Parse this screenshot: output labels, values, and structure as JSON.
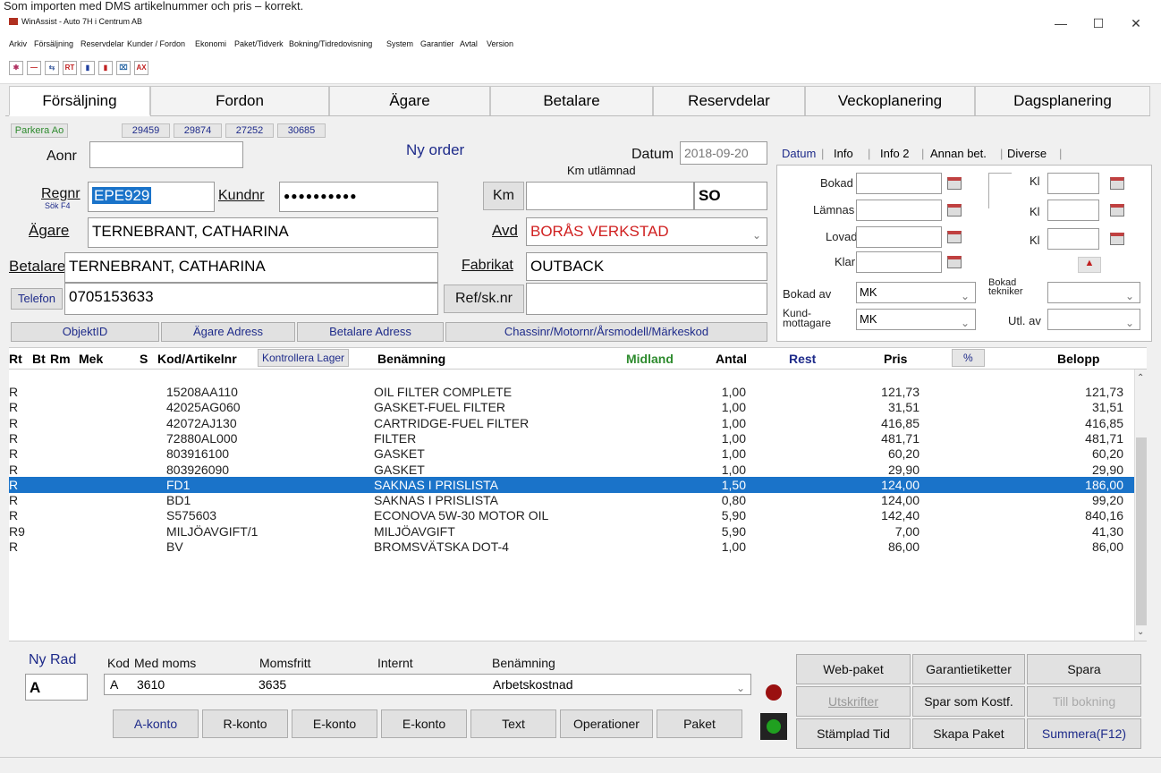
{
  "caption": "Som importen med DMS artikelnummer och pris – korrekt.",
  "window": {
    "title": "WinAssist - Auto 7H i Centrum AB",
    "min": "—",
    "max": "☐",
    "close": "✕"
  },
  "menu": [
    "Arkiv",
    "Försäljning",
    "Reservdelar",
    "Kunder / Fordon",
    "Ekonomi",
    "Paket/Tidverk",
    "Bokning/Tidredovisning",
    "System",
    "Garantier",
    "Avtal",
    "Version"
  ],
  "toolbar": [
    "✱",
    "—",
    "⇆",
    "RT",
    "▮",
    "▮",
    "⌧",
    "AX"
  ],
  "tabs": [
    "Försäljning",
    "Fordon",
    "Ägare",
    "Betalare",
    "Reservdelar",
    "Veckoplanering",
    "Dagsplanering"
  ],
  "parked": {
    "label": "Parkera Ao",
    "orders": [
      "29459",
      "29874",
      "27252",
      "30685"
    ]
  },
  "order": {
    "aonr_label": "Aonr",
    "aonr": "",
    "status": "Ny order",
    "datum_label": "Datum",
    "datum": "2018-09-20",
    "km_utlamnad": "Km utlämnad",
    "regnr_label": "Regnr",
    "regnr_hint": "Sök F4",
    "regnr": "EPE929",
    "kundnr_label": "Kundnr",
    "kundnr": "●●●●●●●●●●",
    "km_button": "Km",
    "km": "",
    "km_code": "SO",
    "agare_label": "Ägare",
    "agare": "TERNEBRANT, CATHARINA",
    "avd_label": "Avd",
    "avd": "BORÅS VERKSTAD",
    "betalare_label": "Betalare",
    "betalare": "TERNEBRANT, CATHARINA",
    "fabrikat_label": "Fabrikat",
    "fabrikat": "OUTBACK",
    "telefon_button": "Telefon",
    "telefon": "0705153633",
    "ref_button": "Ref/sk.nr",
    "ref": ""
  },
  "info_buttons": [
    "ObjektID",
    "Ägare Adress",
    "Betalare Adress",
    "Chassinr/Motornr/Årsmodell/Märkeskod"
  ],
  "subtabs": [
    "Datum",
    "Info",
    "Info 2",
    "Annan bet.",
    "Diverse"
  ],
  "subpanel": {
    "bokad": "Bokad",
    "lamnas": "Lämnas",
    "lovad": "Lovad",
    "klar": "Klar",
    "kl": "Kl",
    "bokad_av_label": "Bokad av",
    "bokad_av": "MK",
    "bokad_tekniker_label": "Bokad tekniker",
    "bokad_tekniker": "",
    "kund_mottagare_label": "Kund-mottagare",
    "kund_mottagare": "MK",
    "utl_av_label": "Utl. av",
    "utl_av": ""
  },
  "columns": {
    "rt": "Rt",
    "bt": "Bt",
    "rm": "Rm",
    "mek": "Mek",
    "s": "S",
    "kod": "Kod/Artikelnr",
    "check": "Kontrollera Lager",
    "benamning": "Benämning",
    "midland": "Midland",
    "antal": "Antal",
    "rest": "Rest",
    "pris": "Pris",
    "pct": "%",
    "belopp": "Belopp"
  },
  "rows": [
    {
      "rt": "R",
      "kod": "15208AA110",
      "ben": "OIL FILTER COMPLETE",
      "antal": "1,00",
      "pris": "121,73",
      "belopp": "121,73"
    },
    {
      "rt": "R",
      "kod": "42025AG060",
      "ben": "GASKET-FUEL FILTER",
      "antal": "1,00",
      "pris": "31,51",
      "belopp": "31,51"
    },
    {
      "rt": "R",
      "kod": "42072AJ130",
      "ben": "CARTRIDGE-FUEL FILTER",
      "antal": "1,00",
      "pris": "416,85",
      "belopp": "416,85"
    },
    {
      "rt": "R",
      "kod": "72880AL000",
      "ben": "FILTER",
      "antal": "1,00",
      "pris": "481,71",
      "belopp": "481,71"
    },
    {
      "rt": "R",
      "kod": "803916100",
      "ben": "GASKET",
      "antal": "1,00",
      "pris": "60,20",
      "belopp": "60,20"
    },
    {
      "rt": "R",
      "kod": "803926090",
      "ben": "GASKET",
      "antal": "1,00",
      "pris": "29,90",
      "belopp": "29,90"
    },
    {
      "rt": "R",
      "kod": "FD1",
      "ben": "SAKNAS I PRISLISTA",
      "antal": "1,50",
      "pris": "124,00",
      "belopp": "186,00"
    },
    {
      "rt": "R",
      "kod": "BD1",
      "ben": "SAKNAS I PRISLISTA",
      "antal": "0,80",
      "pris": "124,00",
      "belopp": "99,20"
    },
    {
      "rt": "R",
      "kod": "S575603",
      "ben": "ECONOVA 5W-30 MOTOR OIL",
      "antal": "5,90",
      "pris": "142,40",
      "belopp": "840,16"
    },
    {
      "rt": "R9",
      "kod": "MILJÖAVGIFT/1",
      "ben": "MILJÖAVGIFT",
      "antal": "5,90",
      "pris": "7,00",
      "belopp": "41,30"
    },
    {
      "rt": "R",
      "kod": "BV",
      "ben": "BROMSVÄTSKA DOT-4",
      "antal": "1,00",
      "pris": "86,00",
      "belopp": "86,00"
    }
  ],
  "selected_row": 6,
  "new_row": {
    "title": "Ny Rad",
    "value": "A",
    "kod_label": "Kod",
    "med_moms_label": "Med moms",
    "momsfritt_label": "Momsfritt",
    "internt_label": "Internt",
    "benamning_label": "Benämning",
    "kod": "A",
    "med_moms": "3610",
    "momsfritt": "3635",
    "internt": "",
    "benamning": "Arbetskostnad"
  },
  "bottom_buttons": [
    "A-konto",
    "R-konto",
    "E-konto",
    "E-konto",
    "Text",
    "Operationer",
    "Paket"
  ],
  "action_buttons": [
    [
      "Web-paket",
      "Garantietiketter",
      "Spara"
    ],
    [
      "Utskrifter",
      "Spar som Kostf.",
      "Till bokning"
    ],
    [
      "Stämplad Tid",
      "Skapa Paket",
      "Summera(F12)"
    ]
  ],
  "colors": {
    "selection": "#1a73c9",
    "red_text": "#d02020",
    "navy": "#1e2b8a",
    "green": "#2e8b2e",
    "led_red": "#9a1010",
    "led_green": "#20a020"
  }
}
